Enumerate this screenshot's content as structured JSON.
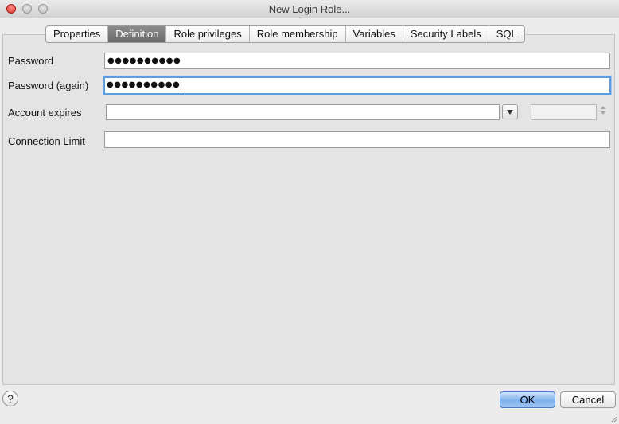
{
  "window": {
    "title": "New Login Role..."
  },
  "tabs": [
    {
      "label": "Properties",
      "active": false
    },
    {
      "label": "Definition",
      "active": true
    },
    {
      "label": "Role privileges",
      "active": false
    },
    {
      "label": "Role membership",
      "active": false
    },
    {
      "label": "Variables",
      "active": false
    },
    {
      "label": "Security Labels",
      "active": false
    },
    {
      "label": "SQL",
      "active": false
    }
  ],
  "form": {
    "password_label": "Password",
    "password_value": "●●●●●●●●●●",
    "password_again_label": "Password (again)",
    "password_again_value": "●●●●●●●●●●",
    "account_expires_label": "Account expires",
    "account_expires_date": "",
    "account_expires_time": "",
    "connection_limit_label": "Connection Limit",
    "connection_limit_value": ""
  },
  "buttons": {
    "help": "?",
    "ok": "OK",
    "cancel": "Cancel"
  },
  "colors": {
    "ok_accent": "#7fb1ec",
    "focus_ring": "#5f9be0",
    "close_light": "#d8362d"
  }
}
